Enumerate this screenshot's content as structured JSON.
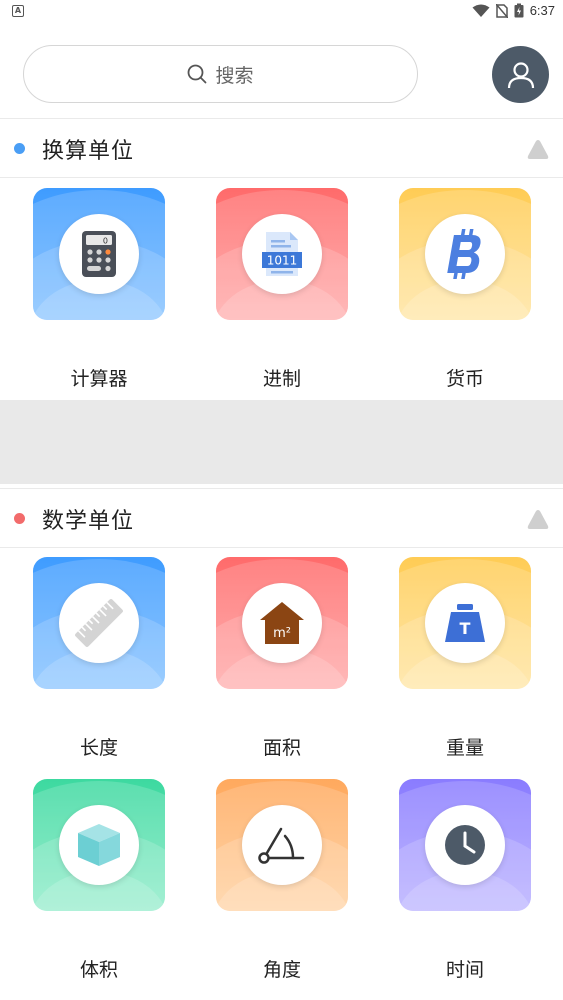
{
  "status_bar": {
    "time": "6:37",
    "app_badge": "A"
  },
  "search": {
    "placeholder": "搜索"
  },
  "sections": [
    {
      "title": "换算单位",
      "dot_color": "#4a9ef5",
      "items": [
        {
          "label": "计算器",
          "icon": "calculator-icon",
          "color": "blue"
        },
        {
          "label": "进制",
          "icon": "binary-file-icon",
          "color": "red"
        },
        {
          "label": "货币",
          "icon": "bitcoin-icon",
          "color": "yellow"
        }
      ]
    },
    {
      "title": "数学单位",
      "dot_color": "#f26b6b",
      "items": [
        {
          "label": "长度",
          "icon": "ruler-icon",
          "color": "blue"
        },
        {
          "label": "面积",
          "icon": "house-area-icon",
          "color": "red"
        },
        {
          "label": "重量",
          "icon": "weight-icon",
          "color": "yellow"
        },
        {
          "label": "体积",
          "icon": "cube-icon",
          "color": "green"
        },
        {
          "label": "角度",
          "icon": "angle-icon",
          "color": "orange"
        },
        {
          "label": "时间",
          "icon": "clock-icon",
          "color": "purple"
        }
      ]
    }
  ],
  "calculator_display": "0",
  "binary_label": "1011",
  "area_unit": "m²",
  "weight_letter": "T"
}
